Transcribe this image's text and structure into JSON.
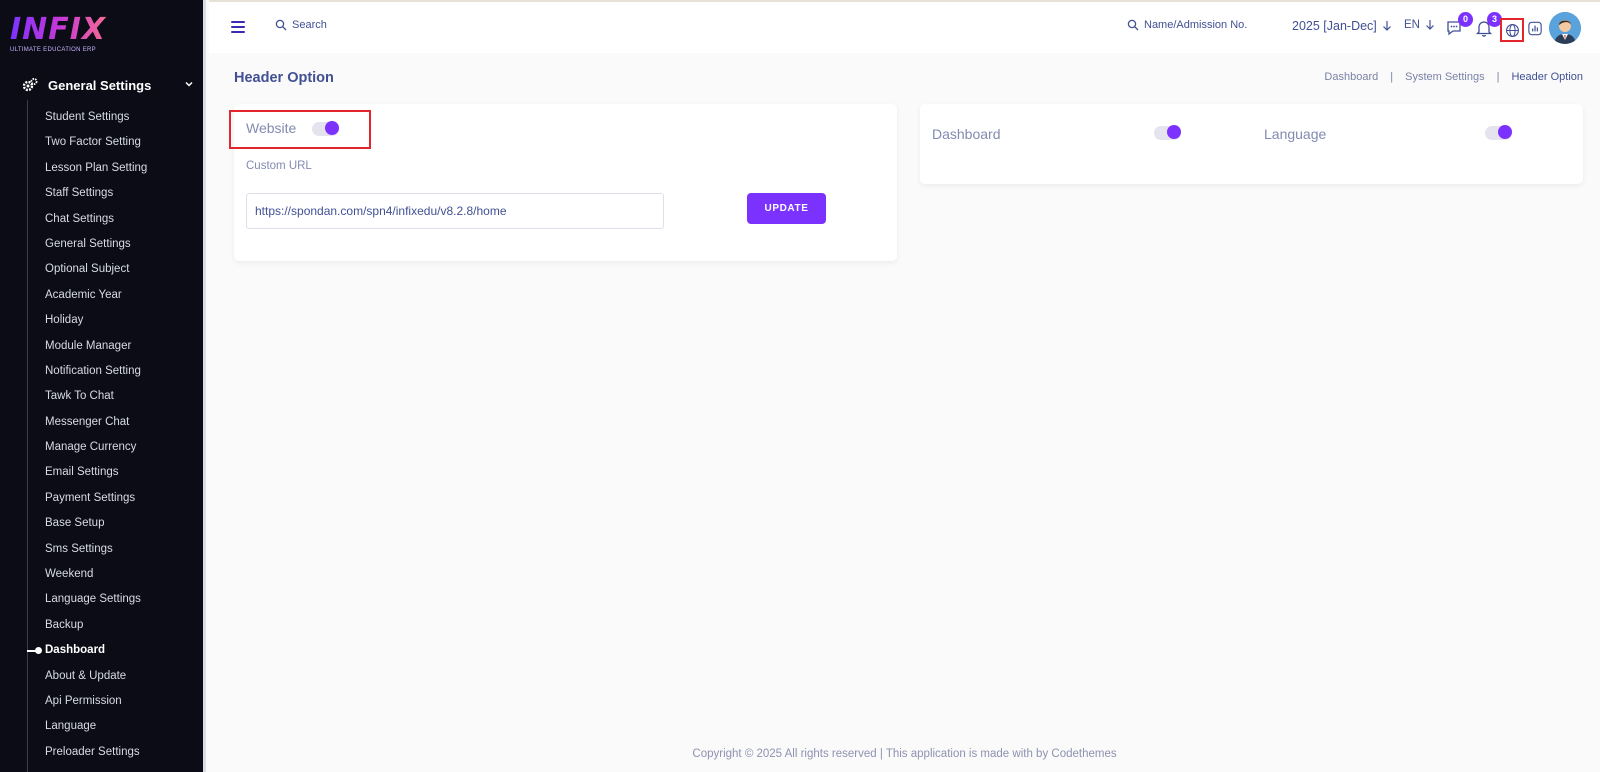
{
  "logo": {
    "word": "INFIX",
    "subtitle": "ULTIMATE EDUCATION ERP"
  },
  "sidebar": {
    "section_title": "General Settings",
    "items": [
      "Student Settings",
      "Two Factor Setting",
      "Lesson Plan Setting",
      "Staff Settings",
      "Chat Settings",
      "General Settings",
      "Optional Subject",
      "Academic Year",
      "Holiday",
      "Module Manager",
      "Notification Setting",
      "Tawk To Chat",
      "Messenger Chat",
      "Manage Currency",
      "Email Settings",
      "Payment Settings",
      "Base Setup",
      "Sms Settings",
      "Weekend",
      "Language Settings",
      "Backup",
      "Dashboard",
      "About & Update",
      "Api Permission",
      "Language",
      "Preloader Settings"
    ],
    "active_item": "Dashboard"
  },
  "header": {
    "search_label": "Search",
    "admission_search_label": "Name/Admission No.",
    "academic_year": "2025 [Jan-Dec]",
    "language_code": "EN",
    "chat_badge": "0",
    "notification_badge": "3"
  },
  "page": {
    "title": "Header Option",
    "breadcrumb": [
      "Dashboard",
      "System Settings",
      "Header Option"
    ]
  },
  "website_card": {
    "website_label": "Website",
    "website_enabled": true,
    "custom_url_label": "Custom URL",
    "custom_url_value": "https://spondan.com/spn4/infixedu/v8.2.8/home",
    "update_label": "UPDATE"
  },
  "options_card": {
    "dashboard_label": "Dashboard",
    "dashboard_enabled": true,
    "language_label": "Language",
    "language_enabled": true
  },
  "footer": {
    "text": "Copyright © 2025 All rights reserved | This application is made with by Codethemes"
  },
  "colors": {
    "accent": "#7c32ff",
    "sidebar_bg": "#0b0c16",
    "highlight": "#e3262d",
    "text": "#415094"
  }
}
